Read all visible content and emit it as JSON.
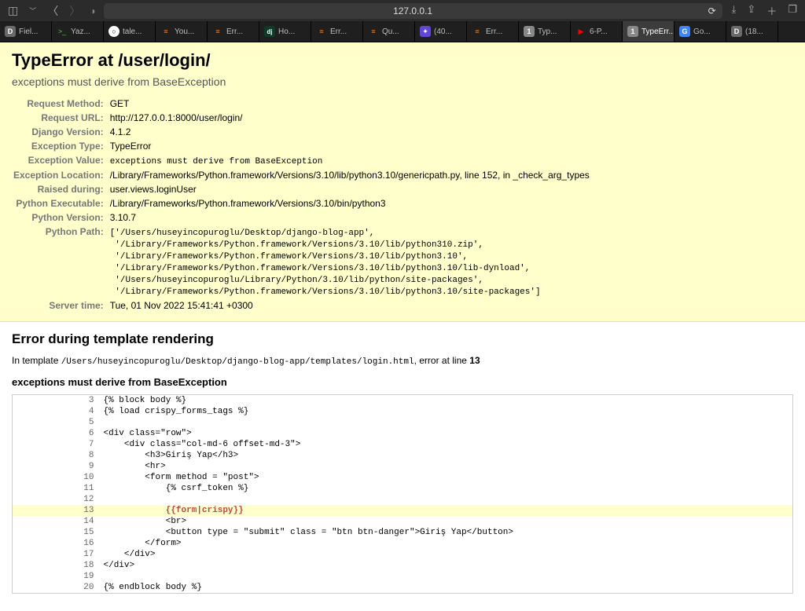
{
  "toolbar": {
    "url": "127.0.0.1"
  },
  "tabs": [
    {
      "icon": "fi-d",
      "iconText": "D",
      "label": "Fiel..."
    },
    {
      "icon": "fi-term",
      "iconText": ">_",
      "label": "Yaz..."
    },
    {
      "icon": "fi-gh",
      "iconText": "○",
      "label": "tale..."
    },
    {
      "icon": "fi-so",
      "iconText": "≡",
      "label": "You..."
    },
    {
      "icon": "fi-so",
      "iconText": "≡",
      "label": "Err..."
    },
    {
      "icon": "fi-dj",
      "iconText": "dj",
      "label": "Ho..."
    },
    {
      "icon": "fi-so",
      "iconText": "≡",
      "label": "Err..."
    },
    {
      "icon": "fi-so",
      "iconText": "≡",
      "label": "Qu..."
    },
    {
      "icon": "fi-br",
      "iconText": "✦",
      "label": "(40..."
    },
    {
      "icon": "fi-so",
      "iconText": "≡",
      "label": "Err..."
    },
    {
      "icon": "fi-1",
      "iconText": "1",
      "label": "Typ..."
    },
    {
      "icon": "fi-yt",
      "iconText": "▶",
      "label": "6-P..."
    },
    {
      "icon": "fi-1",
      "iconText": "1",
      "label": "TypeErr...",
      "active": true
    },
    {
      "icon": "fi-go",
      "iconText": "G",
      "label": "Go..."
    },
    {
      "icon": "fi-d",
      "iconText": "D",
      "label": "(18..."
    }
  ],
  "error": {
    "title": "TypeError at /user/login/",
    "subtitle": "exceptions must derive from BaseException",
    "meta": [
      {
        "k": "Request Method:",
        "v": "GET"
      },
      {
        "k": "Request URL:",
        "v": "http://127.0.0.1:8000/user/login/"
      },
      {
        "k": "Django Version:",
        "v": "4.1.2"
      },
      {
        "k": "Exception Type:",
        "v": "TypeError"
      },
      {
        "k": "Exception Value:",
        "v": "exceptions must derive from BaseException",
        "mono": true
      },
      {
        "k": "Exception Location:",
        "v": "/Library/Frameworks/Python.framework/Versions/3.10/lib/python3.10/genericpath.py, line 152, in _check_arg_types"
      },
      {
        "k": "Raised during:",
        "v": "user.views.loginUser"
      },
      {
        "k": "Python Executable:",
        "v": "/Library/Frameworks/Python.framework/Versions/3.10/bin/python3"
      },
      {
        "k": "Python Version:",
        "v": "3.10.7"
      },
      {
        "k": "Python Path:",
        "v": "['/Users/huseyincopuroglu/Desktop/django-blog-app',\n '/Library/Frameworks/Python.framework/Versions/3.10/lib/python310.zip',\n '/Library/Frameworks/Python.framework/Versions/3.10/lib/python3.10',\n '/Library/Frameworks/Python.framework/Versions/3.10/lib/python3.10/lib-dynload',\n '/Users/huseyincopuroglu/Library/Python/3.10/lib/python/site-packages',\n '/Library/Frameworks/Python.framework/Versions/3.10/lib/python3.10/site-packages']",
        "mono": true
      },
      {
        "k": "Server time:",
        "v": "Tue, 01 Nov 2022 15:41:41 +0300"
      }
    ]
  },
  "template_error": {
    "heading": "Error during template rendering",
    "intro_pre": "In template ",
    "template_path": "/Users/huseyincopuroglu/Desktop/django-blog-app/templates/login.html",
    "intro_mid": ", error at line ",
    "line_no": "13",
    "sub": "exceptions must derive from BaseException",
    "lines": [
      {
        "n": "3",
        "c": "{% block body %}"
      },
      {
        "n": "4",
        "c": "{% load crispy_forms_tags %}"
      },
      {
        "n": "5",
        "c": ""
      },
      {
        "n": "6",
        "c": "<div class=\"row\">"
      },
      {
        "n": "7",
        "c": "    <div class=\"col-md-6 offset-md-3\">"
      },
      {
        "n": "8",
        "c": "        <h3>Giriş Yap</h3>"
      },
      {
        "n": "9",
        "c": "        <hr>"
      },
      {
        "n": "10",
        "c": "        <form method = \"post\">"
      },
      {
        "n": "11",
        "c": "            {% csrf_token %}"
      },
      {
        "n": "12",
        "c": ""
      },
      {
        "n": "13",
        "c": "            {{form|crispy}}",
        "hl": true
      },
      {
        "n": "14",
        "c": "            <br>"
      },
      {
        "n": "15",
        "c": "            <button type = \"submit\" class = \"btn btn-danger\">Giriş Yap</button>"
      },
      {
        "n": "16",
        "c": "        </form>"
      },
      {
        "n": "17",
        "c": "    </div>"
      },
      {
        "n": "18",
        "c": "</div>"
      },
      {
        "n": "19",
        "c": ""
      },
      {
        "n": "20",
        "c": "{% endblock body %}"
      }
    ]
  }
}
